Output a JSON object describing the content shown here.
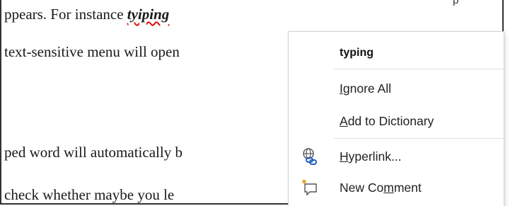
{
  "document": {
    "lines": [
      {
        "before": "ppears. For instance ",
        "misspelled": "tyiping"
      },
      {
        "text": "text-sensitive menu will open"
      },
      {
        "text": "ped word will automatically b"
      },
      {
        "text": "check whether maybe you le"
      }
    ],
    "corner_text": "p"
  },
  "context_menu": {
    "suggestion": "typing",
    "items": [
      {
        "label": "Ignore All",
        "accel_pre": "",
        "accel": "I",
        "accel_post": "gnore All"
      },
      {
        "label": "Add to Dictionary",
        "accel_pre": "",
        "accel": "A",
        "accel_post": "dd to Dictionary"
      },
      {
        "label": "Hyperlink...",
        "accel_pre": "",
        "accel": "H",
        "accel_post": "yperlink...",
        "icon": "hyperlink-icon"
      },
      {
        "label": "New Comment",
        "accel_pre": "New Co",
        "accel": "m",
        "accel_post": "ment",
        "icon": "new-comment-icon"
      }
    ]
  }
}
